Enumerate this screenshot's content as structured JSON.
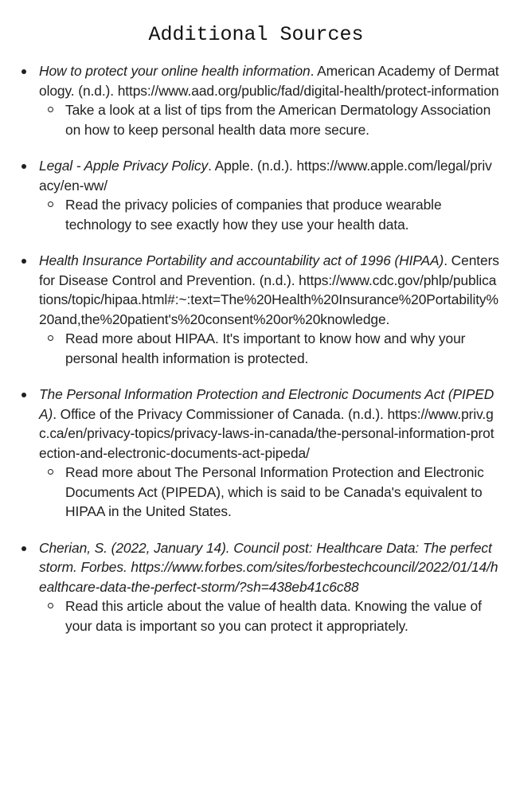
{
  "title": "Additional Sources",
  "sources": [
    {
      "italic": "How to protect your online health information",
      "rest": ". American Academy of Dermatology. (n.d.). https://www.aad.org/public/fad/digital-health/protect-information",
      "note": "Take a look at a list of tips from the American Dermatology Association on how to keep personal health data more secure."
    },
    {
      "italic": "Legal - Apple Privacy Policy",
      "rest": ". Apple. (n.d.). https://www.apple.com/legal/privacy/en-ww/",
      "note": "Read the privacy policies of companies that produce wearable technology to see exactly how they use your health data."
    },
    {
      "italic": "Health Insurance Portability and accountability act of 1996 (HIPAA)",
      "rest": ". Centers for Disease Control and Prevention. (n.d.). https://www.cdc.gov/phlp/publications/topic/hipaa.html#:~:text=The%20Health%20Insurance%20Portability%20and,the%20patient's%20consent%20or%20knowledge.",
      "note": "Read more about HIPAA. It's important to know how and why your personal health information is protected."
    },
    {
      "italic": "The Personal Information Protection and Electronic Documents Act (PIPEDA)",
      "rest": ". Office of the Privacy Commissioner of Canada. (n.d.). https://www.priv.gc.ca/en/privacy-topics/privacy-laws-in-canada/the-personal-information-protection-and-electronic-documents-act-pipeda/",
      "note": "Read more about The Personal Information Protection and Electronic Documents Act (PIPEDA), which is said to be Canada's equivalent to HIPAA in the United States."
    },
    {
      "italic": "Cherian, S. (2022, January 14). Council post: Healthcare Data: The perfect storm. Forbes. https://www.forbes.com/sites/forbestechcouncil/2022/01/14/healthcare-data-the-perfect-storm/?sh=438eb41c6c88",
      "rest": "",
      "note": "Read this article about the value of health data. Knowing the value of your data is important so you can protect it appropriately."
    }
  ]
}
